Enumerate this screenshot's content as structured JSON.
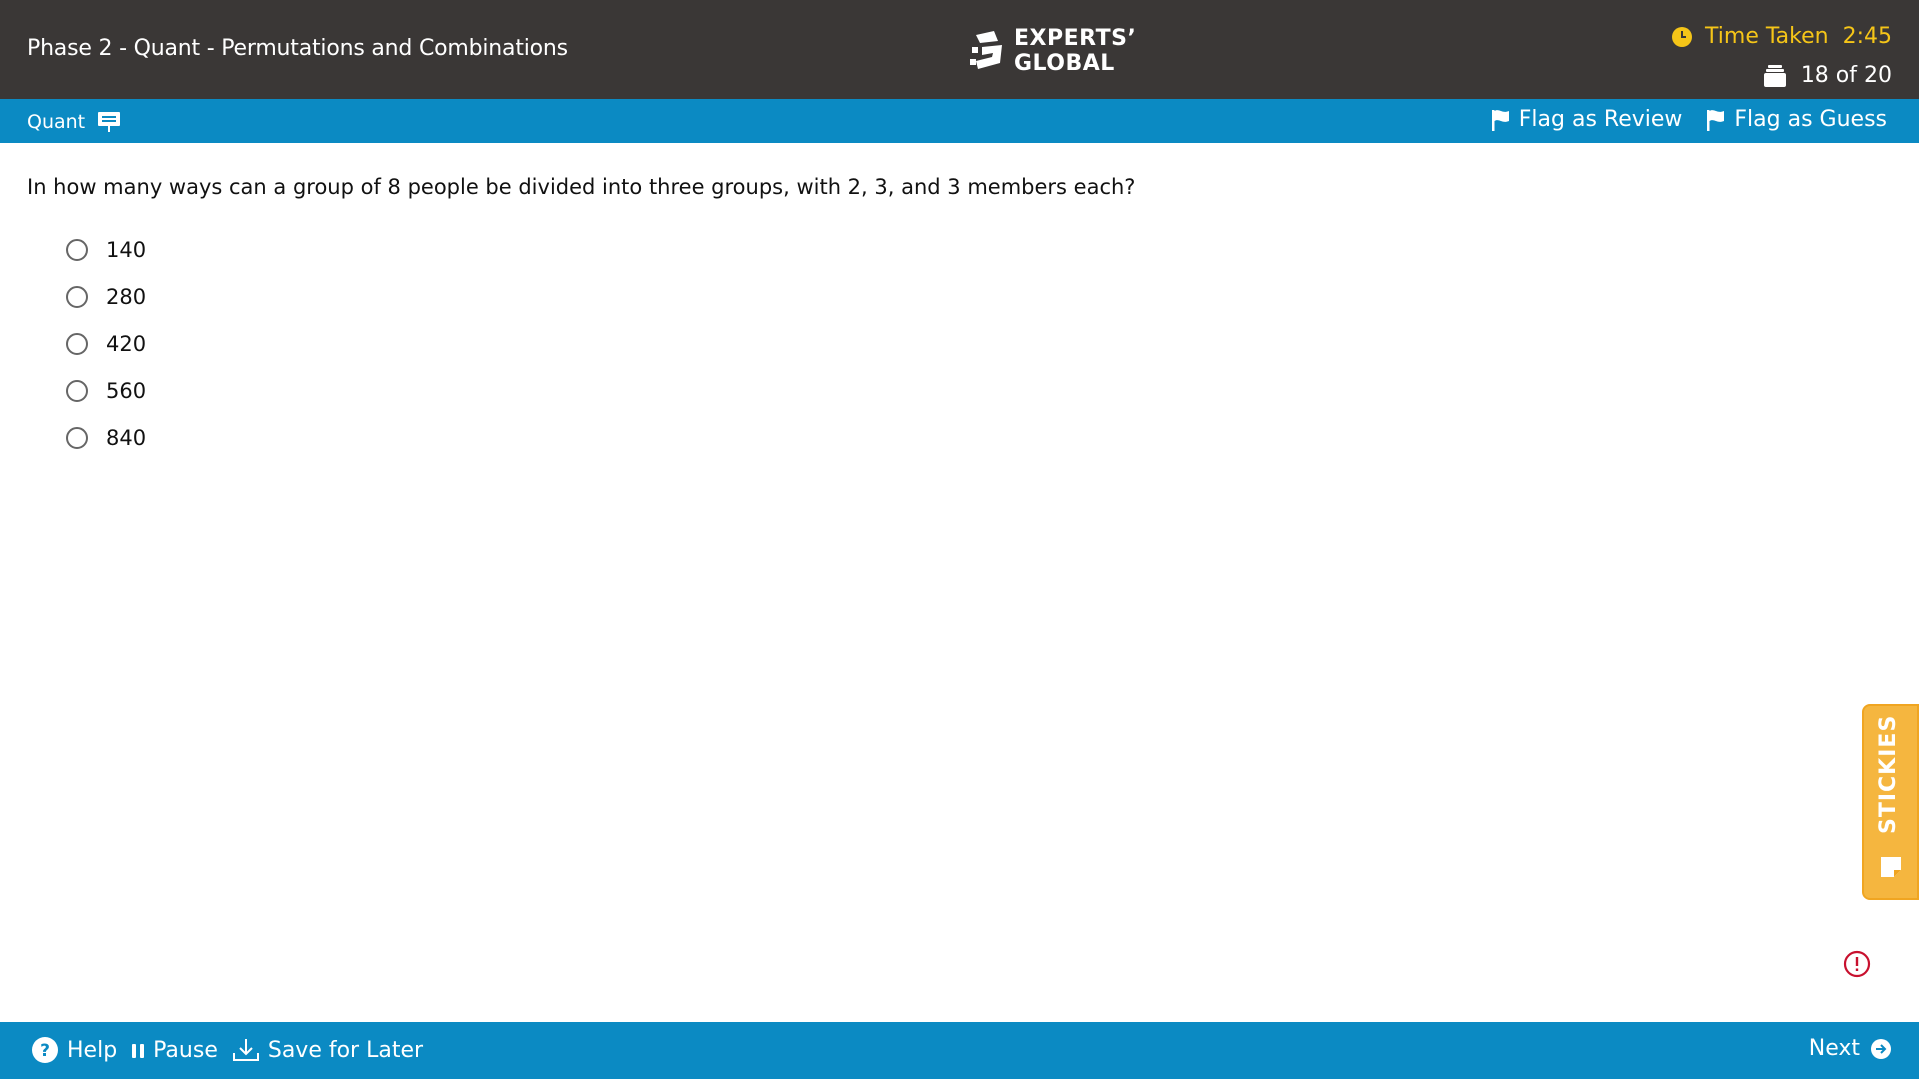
{
  "header": {
    "title": "Phase 2 - Quant - Permutations and Combinations",
    "logo_line1": "EXPERTS’",
    "logo_line2": "GLOBAL",
    "time_label": "Time Taken",
    "time_value": "2:45",
    "counter": "18 of 20"
  },
  "subbar": {
    "section": "Quant",
    "flag_review": "Flag as Review",
    "flag_guess": "Flag as Guess"
  },
  "question": {
    "text": "In how many ways can a group of 8 people be divided into three groups, with 2, 3, and 3 members each?",
    "options": [
      "140",
      "280",
      "420",
      "560",
      "840"
    ]
  },
  "stickies": {
    "label": "STICKIES"
  },
  "footer": {
    "help": "Help",
    "pause": "Pause",
    "save": "Save for Later",
    "next": "Next"
  },
  "colors": {
    "header_bg": "#3a3736",
    "bar_blue": "#0b8ac3",
    "timer_yellow": "#f5c518",
    "stickies_orange": "#f5b63f",
    "alert_red": "#c8102e"
  }
}
